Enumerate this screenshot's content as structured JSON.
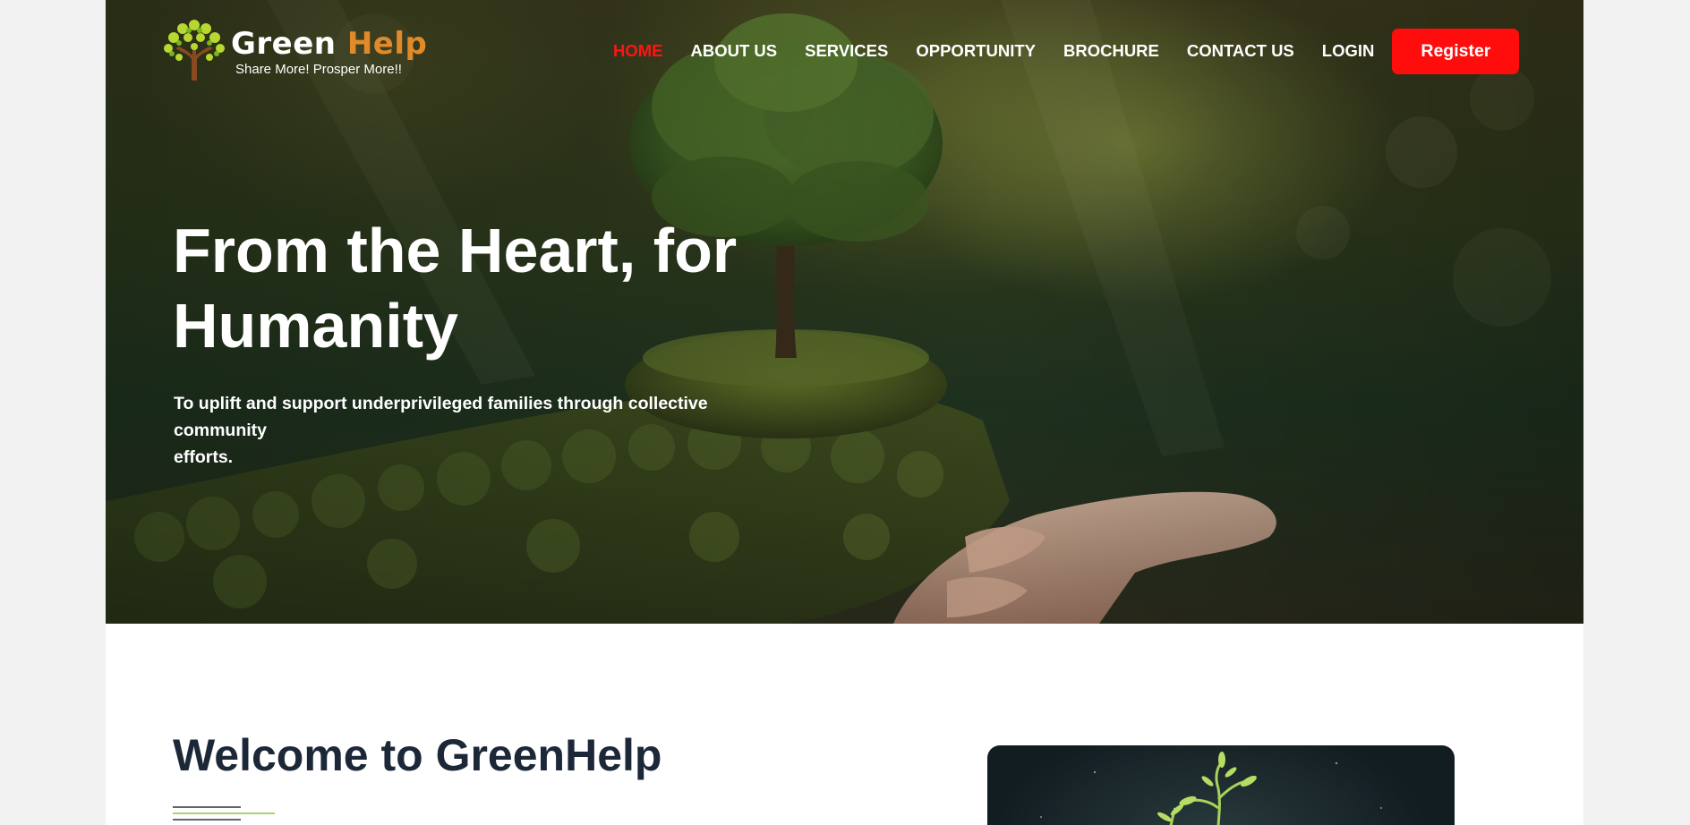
{
  "brand": {
    "name_part1": "Green",
    "name_part2": "Help",
    "tagline": "Share More! Prosper More!!"
  },
  "nav": {
    "items": [
      {
        "label": "HOME",
        "active": true
      },
      {
        "label": "ABOUT US",
        "active": false
      },
      {
        "label": "SERVICES",
        "active": false
      },
      {
        "label": "OPPORTUNITY",
        "active": false
      },
      {
        "label": "BROCHURE",
        "active": false
      },
      {
        "label": "CONTACT US",
        "active": false
      },
      {
        "label": "LOGIN",
        "active": false
      }
    ],
    "register_label": "Register"
  },
  "hero": {
    "title_line1": "From the Heart, for",
    "title_line2": "Humanity",
    "subtitle_line1": "To uplift and support underprivileged families through collective community",
    "subtitle_line2": "efforts."
  },
  "welcome": {
    "title": "Welcome to GreenHelp"
  },
  "colors": {
    "accent_red": "#ff0d0d",
    "active_nav": "#ff1414",
    "brand_orange": "#e08a2a",
    "heading_dark": "#1c2838",
    "divider_green": "#8cc63f"
  }
}
